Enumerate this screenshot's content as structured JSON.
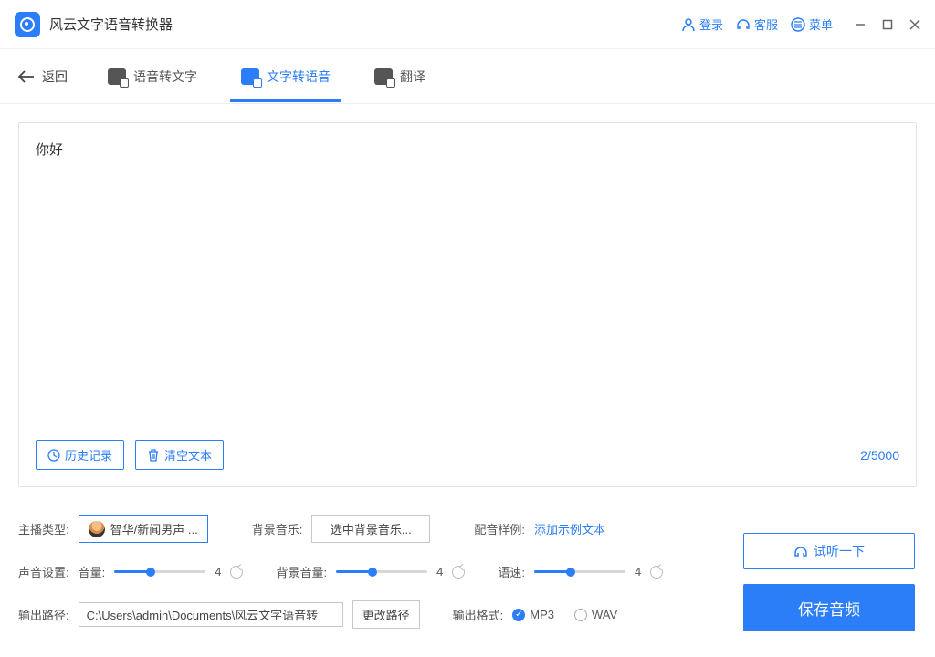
{
  "app": {
    "title": "风云文字语音转换器"
  },
  "titlebar": {
    "login": "登录",
    "support": "客服",
    "menu": "菜单"
  },
  "nav": {
    "back": "返回",
    "tabs": [
      {
        "label": "语音转文字"
      },
      {
        "label": "文字转语音"
      },
      {
        "label": "翻译"
      }
    ]
  },
  "editor": {
    "text": "你好",
    "history_btn": "历史记录",
    "clear_btn": "清空文本",
    "char_count": "2/5000"
  },
  "settings": {
    "anchor_label": "主播类型:",
    "anchor_value": "智华/新闻男声 ...",
    "bgm_label": "背景音乐:",
    "bgm_value": "选中背景音乐...",
    "sample_label": "配音样例:",
    "sample_link": "添加示例文本",
    "sound_label": "声音设置:",
    "volume_label": "音量:",
    "volume_value": "4",
    "bgm_vol_label": "背景音量:",
    "bgm_vol_value": "4",
    "speed_label": "语速:",
    "speed_value": "4",
    "path_label": "输出路径:",
    "path_value": "C:\\Users\\admin\\Documents\\风云文字语音转",
    "change_path": "更改路径",
    "format_label": "输出格式:",
    "format_mp3": "MP3",
    "format_wav": "WAV"
  },
  "actions": {
    "preview": "试听一下",
    "save": "保存音频"
  }
}
